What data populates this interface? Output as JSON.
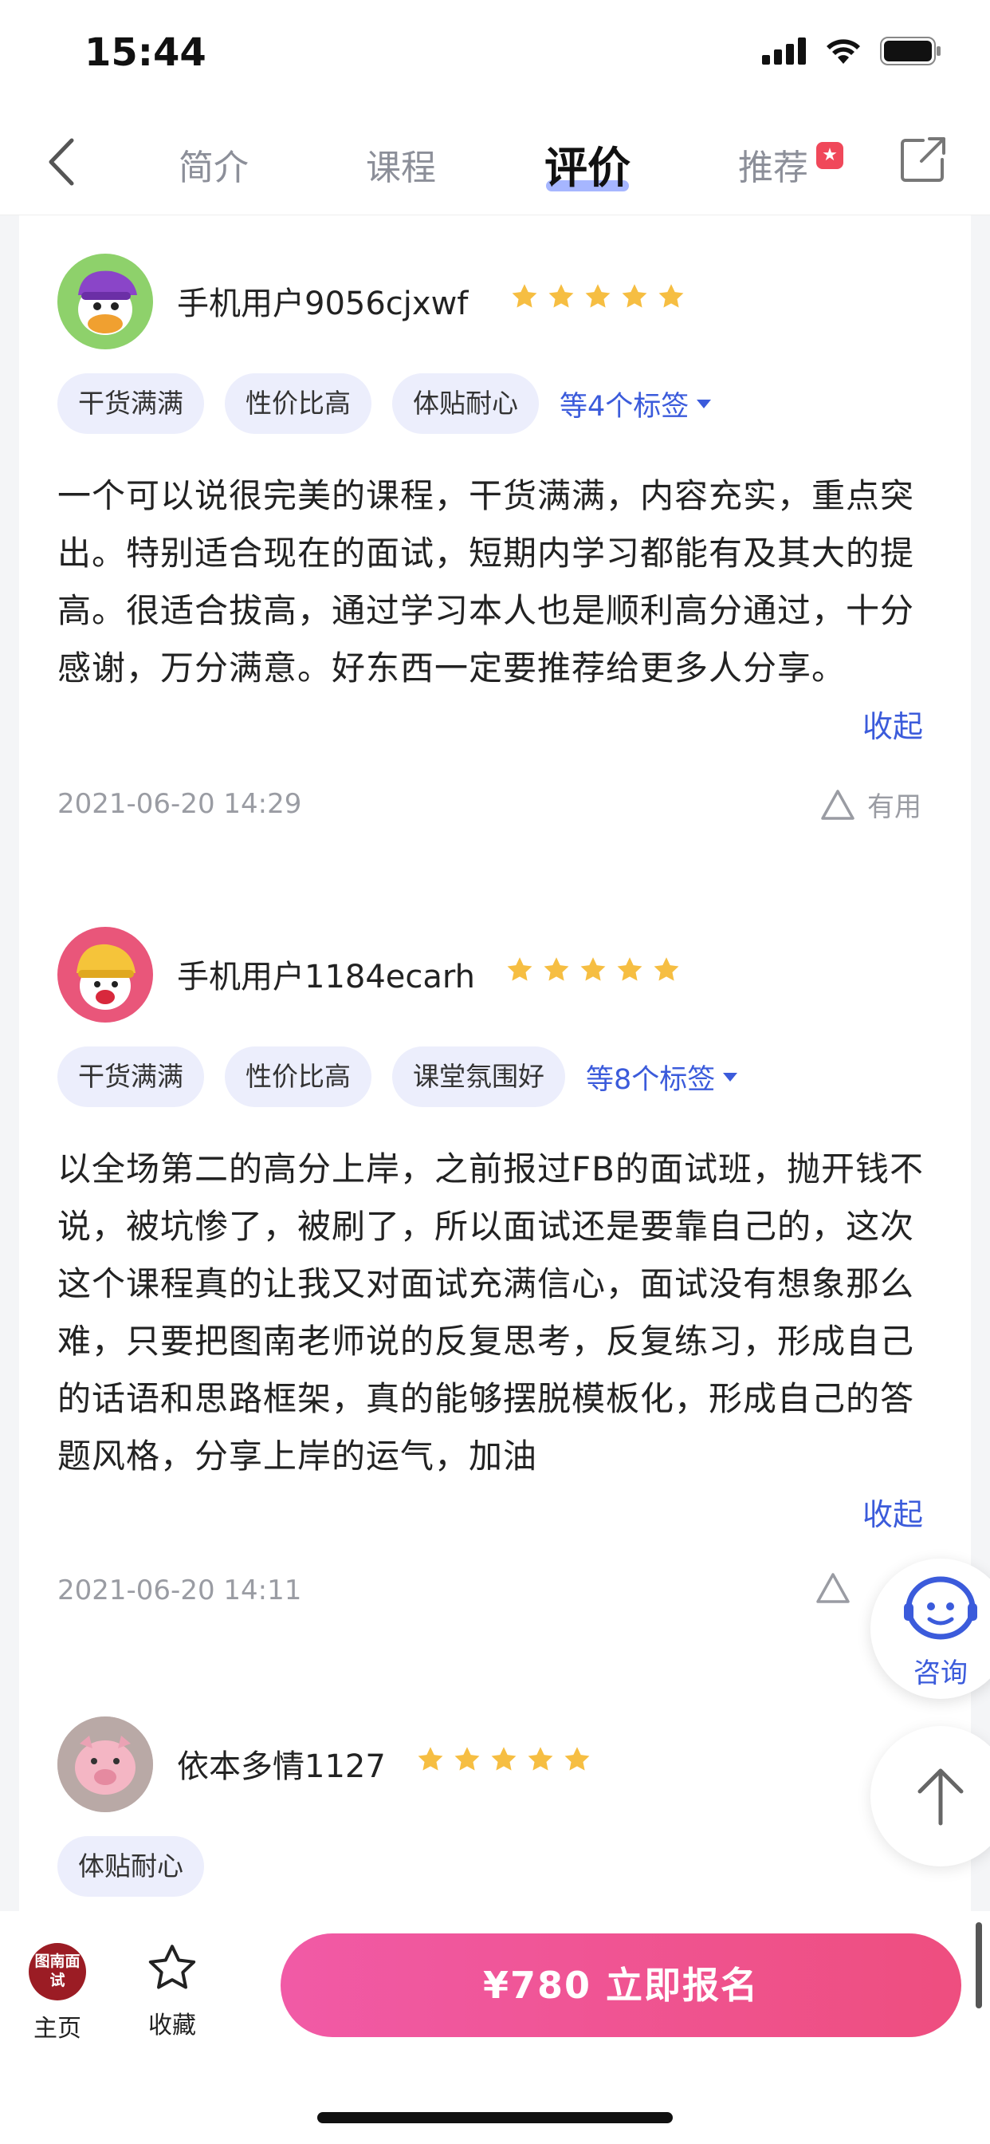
{
  "status_bar": {
    "time": "15:44"
  },
  "nav": {
    "tabs": [
      {
        "label": "简介"
      },
      {
        "label": "课程"
      },
      {
        "label": "评价"
      },
      {
        "label": "推荐"
      }
    ],
    "active_tab": "评价"
  },
  "reviews": [
    {
      "username": "手机用户9056cjxwf",
      "rating": 5,
      "tags": [
        "干货满满",
        "性价比高",
        "体贴耐心"
      ],
      "more_tags": "等4个标签",
      "body": "一个可以说很完美的课程，干货满满，内容充实，重点突出。特别适合现在的面试，短期内学习都能有及其大的提高。很适合拔高，通过学习本人也是顺利高分通过，十分感谢，万分满意。好东西一定要推荐给更多人分享。",
      "collapse": "收起",
      "date": "2021-06-20 14:29",
      "useful": "有用"
    },
    {
      "username": "手机用户1184ecarh",
      "rating": 5,
      "tags": [
        "干货满满",
        "性价比高",
        "课堂氛围好"
      ],
      "more_tags": "等8个标签",
      "body": "以全场第二的高分上岸，之前报过FB的面试班，抛开钱不说，被坑惨了，被刷了，所以面试还是要靠自己的，这次这个课程真的让我又对面试充满信心，面试没有想象那么难，只要把图南老师说的反复思考，反复练习，形成自己的话语和思路框架，真的能够摆脱模板化，形成自己的答题风格，分享上岸的运气，加油",
      "collapse": "收起",
      "date": "2021-06-20 14:11"
    },
    {
      "username": "依本多情1127",
      "rating": 5,
      "tags": [
        "体贴耐心"
      ]
    }
  ],
  "float": {
    "consult_label": "咨询"
  },
  "bottom": {
    "home_logo": "图南面试",
    "home_label": "主页",
    "fav_label": "收藏",
    "enroll_label": "¥780 立即报名"
  },
  "colors": {
    "accent": "#3b5bdb",
    "star": "#f6be42",
    "enroll_start": "#f15aa6",
    "enroll_end": "#ee4e7f",
    "tag_bg": "#eceefc"
  }
}
